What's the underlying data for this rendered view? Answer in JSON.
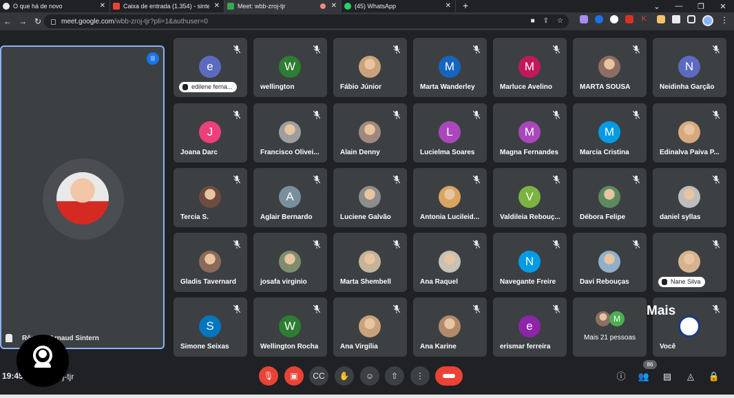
{
  "browser": {
    "tabs": [
      {
        "label": "O que há de novo",
        "icon_color": "#e8eaed"
      },
      {
        "label": "Caixa de entrada (1.354) - sinter",
        "icon_color": "#ea4335"
      },
      {
        "label": "Meet: wbb-zroj-tjr",
        "icon_color": "#34a853",
        "active": true,
        "recording": true
      },
      {
        "label": "(45) WhatsApp",
        "icon_color": "#25d366"
      }
    ],
    "url_host": "meet.google.com",
    "url_path": "/wbb-zroj-tjr?pli=1&authuser=0",
    "extension_colors": [
      "#a78bfa",
      "#1a73e8",
      "#ffffff",
      "#d93025",
      "#ea4335",
      "#f6c26b",
      "#e8eaed",
      "#e8eaed"
    ]
  },
  "pinned": {
    "name": "Rômulo Arnaud Sintern"
  },
  "mais_label": "Mais",
  "tiles": [
    {
      "name": "edilene ferna...",
      "initial": "e",
      "color": "#5c6bc0",
      "hand": true
    },
    {
      "name": "wellington",
      "initial": "W",
      "color": "#2e7d32"
    },
    {
      "name": "Fábio Júnior",
      "photo": true,
      "color": "#c9a27c"
    },
    {
      "name": "Marta Wanderley",
      "initial": "M",
      "color": "#1565c0"
    },
    {
      "name": "Marluce Avelino",
      "initial": "M",
      "color": "#c2185b"
    },
    {
      "name": "MARTA SOUSA",
      "photo": true,
      "color": "#8d6e63"
    },
    {
      "name": "Neidinha Garção",
      "initial": "N",
      "color": "#5c6bc0"
    },
    {
      "name": "Joana Darc",
      "initial": "J",
      "color": "#ec407a"
    },
    {
      "name": "Francisco Olivei...",
      "photo": true,
      "color": "#9e9e9e"
    },
    {
      "name": "Alain Denny",
      "photo": true,
      "color": "#a1887f"
    },
    {
      "name": "Lucielma Soares",
      "initial": "L",
      "color": "#ab47bc"
    },
    {
      "name": "Magna Fernandes",
      "initial": "M",
      "color": "#ab47bc"
    },
    {
      "name": "Marcia Cristina",
      "initial": "M",
      "color": "#039be5"
    },
    {
      "name": "Edinalva Paiva P...",
      "photo": true,
      "color": "#d7a97e"
    },
    {
      "name": "Tercia S.",
      "photo": true,
      "color": "#6d4c41"
    },
    {
      "name": "Aglair Bernardo",
      "initial": "A",
      "color": "#78909c"
    },
    {
      "name": "Luciene Galvão",
      "photo": true,
      "color": "#8d8d8d"
    },
    {
      "name": "Antonia Lucileid...",
      "photo": true,
      "color": "#d8a45f"
    },
    {
      "name": "Valdileia Rebouç...",
      "initial": "V",
      "color": "#7cb342"
    },
    {
      "name": "Débora Felipe",
      "photo": true,
      "color": "#5d8a5e"
    },
    {
      "name": "daniel syllas",
      "photo": true,
      "color": "#bdbdbd"
    },
    {
      "name": "Gladis Tavernard",
      "photo": true,
      "color": "#8a6a5a"
    },
    {
      "name": "josafa virginio",
      "photo": true,
      "color": "#7f8c6f"
    },
    {
      "name": "Marta Shembell",
      "photo": true,
      "color": "#c5b39a"
    },
    {
      "name": "Ana Raquel",
      "photo": true,
      "color": "#c7c2b6"
    },
    {
      "name": "Navegante Freire",
      "initial": "N",
      "color": "#039be5"
    },
    {
      "name": "Davi Rebouças",
      "photo": true,
      "color": "#8fb0c8"
    },
    {
      "name": "Nane Silva",
      "photo": true,
      "color": "#d6b38f",
      "hand": true
    },
    {
      "name": "Simone Seixas",
      "initial": "S",
      "color": "#0277bd"
    },
    {
      "name": "Wellington Rocha",
      "initial": "W",
      "color": "#2e7d32"
    },
    {
      "name": "Ana Virgília",
      "photo": true,
      "color": "#c9a27c"
    },
    {
      "name": "Ana Karine",
      "photo": true,
      "color": "#b08a6a"
    },
    {
      "name": "erismar ferreira",
      "initial": "e",
      "color": "#8e24aa"
    },
    {
      "name": "Mais 21 pessoas",
      "more": true,
      "more_initial": "M"
    },
    {
      "name": "Você",
      "photo": true,
      "color": "#ffffff",
      "self": true
    }
  ],
  "footer": {
    "time": "19:45",
    "meeting_code": "wbb-zroj-tjr",
    "participant_count": "86"
  }
}
